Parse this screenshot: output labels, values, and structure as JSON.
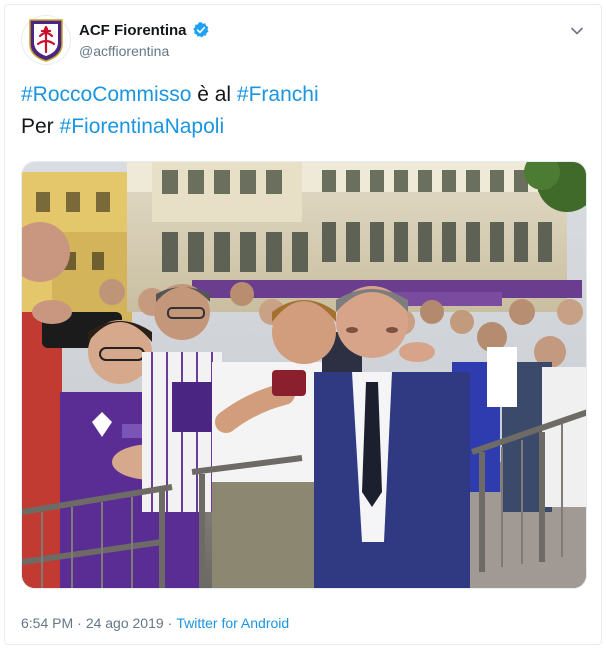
{
  "account": {
    "display_name": "ACF Fiorentina",
    "handle": "@acffiorentina",
    "verified": true
  },
  "tweet": {
    "line1": {
      "hashtag1": "#RoccoCommisso",
      "text_between": " è al ",
      "hashtag2": "#Franchi"
    },
    "line2": {
      "text_before": "Per ",
      "hashtag": "#FiorentinaNapoli"
    }
  },
  "footer": {
    "time": "6:54 PM",
    "separator": "·",
    "date": "24 ago 2019",
    "source": "Twitter for Android"
  },
  "colors": {
    "link": "#1b95e0",
    "text": "#14171a",
    "secondary": "#657786",
    "verified": "#1da1f2",
    "fiorentina_purple": "#4b2582"
  },
  "icons": {
    "verified": "verified-badge-icon",
    "caret": "chevron-down-icon"
  }
}
